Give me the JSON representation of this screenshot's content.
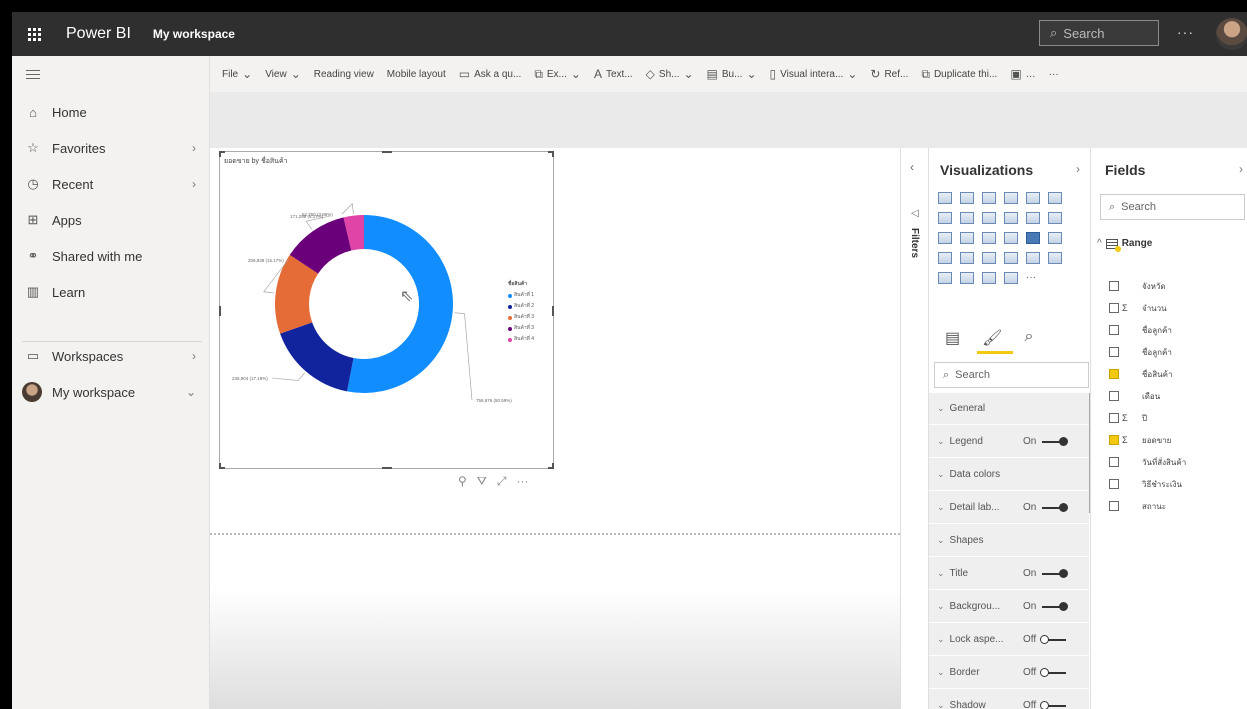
{
  "app": {
    "brand": "Power BI",
    "workspace": "My workspace"
  },
  "topbar": {
    "search_placeholder": "Search",
    "more": "···"
  },
  "nav": {
    "items": [
      {
        "label": "Home",
        "icon": "home-icon"
      },
      {
        "label": "Favorites",
        "icon": "star-icon"
      },
      {
        "label": "Recent",
        "icon": "clock-icon"
      },
      {
        "label": "Apps",
        "icon": "apps-icon"
      },
      {
        "label": "Shared with me",
        "icon": "shared-icon"
      },
      {
        "label": "Learn",
        "icon": "book-icon"
      },
      {
        "label": "Workspaces",
        "icon": "workspaces-icon"
      },
      {
        "label": "My workspace",
        "icon": "avatar"
      }
    ]
  },
  "ribbon": {
    "items": [
      "File",
      "View",
      "Reading view",
      "Mobile layout",
      "Ask a qu...",
      "Ex...",
      "Text...",
      "Sh...",
      "Bu...",
      "Visual intera...",
      "Ref...",
      "Duplicate thi..."
    ]
  },
  "visual": {
    "title": "ยอดขาย by ชื่อสินค้า",
    "legend_title": "ชื่อสินค้า",
    "actions": [
      "pin-icon",
      "filter-icon",
      "focus-icon",
      "more-icon"
    ]
  },
  "chart_data": {
    "type": "pie",
    "donut": true,
    "title": "ยอดขาย by ชื่อสินค้า",
    "legend_title": "ชื่อสินค้า",
    "legend_position": "right",
    "categories": [
      "สินค้าที่ 1",
      "สินค้าที่ 2",
      "สินค้าที่ 3",
      "สินค้าที่ 3",
      "สินค้าที่ 4"
    ],
    "values": [
      756876,
      235904,
      209838,
      171298,
      52750
    ],
    "percent": [
      50.59,
      17.19,
      15.17,
      8.17,
      3.85
    ],
    "colors": [
      "#118dff",
      "#12239e",
      "#e66c37",
      "#6b007b",
      "#e044a7"
    ],
    "data_labels": [
      "756,876 (50.59%)",
      "235,904 (17.19%)",
      "209,838 (15.17%)",
      "171,298 (8.17%)",
      "52,750 (3.85%)"
    ]
  },
  "filters": {
    "label": "Filters"
  },
  "visualizations": {
    "title": "Visualizations",
    "search_placeholder": "Search",
    "format_sections": [
      {
        "label": "General",
        "state": ""
      },
      {
        "label": "Legend",
        "state": "On"
      },
      {
        "label": "Data colors",
        "state": ""
      },
      {
        "label": "Detail lab...",
        "state": "On"
      },
      {
        "label": "Shapes",
        "state": ""
      },
      {
        "label": "Title",
        "state": "On"
      },
      {
        "label": "Backgrou...",
        "state": "On"
      },
      {
        "label": "Lock aspe...",
        "state": "Off"
      },
      {
        "label": "Border",
        "state": "Off"
      },
      {
        "label": "Shadow",
        "state": "Off"
      }
    ]
  },
  "fields": {
    "title": "Fields",
    "search_placeholder": "Search",
    "table": "Range",
    "items": [
      {
        "name": "จังหวัด",
        "sigma": false,
        "checked": false
      },
      {
        "name": "จำนวน",
        "sigma": true,
        "checked": false
      },
      {
        "name": "ชื่อลูกค้า",
        "sigma": false,
        "checked": false
      },
      {
        "name": "ชื่อลูกค้า",
        "sigma": false,
        "checked": false
      },
      {
        "name": "ชื่อสินค้า",
        "sigma": false,
        "checked": true
      },
      {
        "name": "เดือน",
        "sigma": false,
        "checked": false
      },
      {
        "name": "ปี",
        "sigma": true,
        "checked": false
      },
      {
        "name": "ยอดขาย",
        "sigma": true,
        "checked": true
      },
      {
        "name": "วันที่สั่งสินค้า",
        "sigma": false,
        "checked": false
      },
      {
        "name": "วิธีชำระเงิน",
        "sigma": false,
        "checked": false
      },
      {
        "name": "สถานะ",
        "sigma": false,
        "checked": false
      }
    ]
  }
}
